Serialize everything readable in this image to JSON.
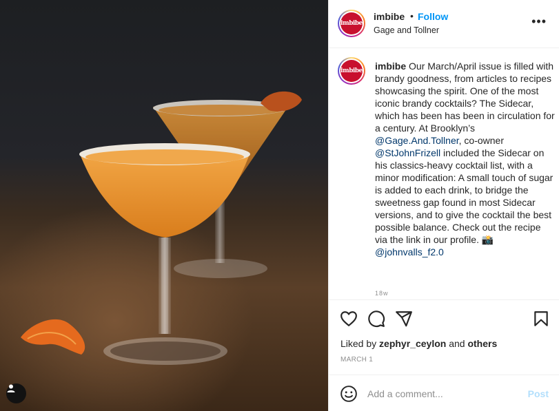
{
  "post": {
    "image_alt": "Two sidecar cocktails in sugar-rimmed coupe glasses with orange peel garnish on a wooden table"
  },
  "header": {
    "username": "imbibe",
    "separator": "•",
    "follow_label": "Follow",
    "location": "Gage and Tollner",
    "more_label": "•••",
    "avatar_text": "imbibe"
  },
  "caption": {
    "username": "imbibe",
    "part1": " Our March/April issue is filled with brandy goodness, from articles to recipes showcasing the spirit. One of the most iconic brandy cocktails? The Sidecar, which has been has been in circulation for a century. At Brooklyn’s ",
    "mention1": "@Gage.And.Tollner",
    "part2": ", co-owner ",
    "mention2": "@StJohnFrizell",
    "part3": " included the Sidecar on his classics-heavy cocktail list, with a minor modification: A small touch of sugar is added to each drink, to bridge the sweetness gap found in most Sidecar versions, and to give the cocktail the best possible balance. Check out the recipe via the link in our profile. 📸",
    "mention3": "@johnvalls_f2.0",
    "timestamp_partial": "18w"
  },
  "likes": {
    "prefix": "Liked by ",
    "user": "zephyr_ceylon",
    "middle": " and ",
    "others": "others"
  },
  "date": "MARCH 1",
  "comment": {
    "placeholder": "Add a comment...",
    "post_label": "Post"
  },
  "colors": {
    "accent": "#0095f6",
    "post_disabled": "#b2dffc",
    "brand_red": "#c8102e",
    "mention": "#00376b"
  }
}
